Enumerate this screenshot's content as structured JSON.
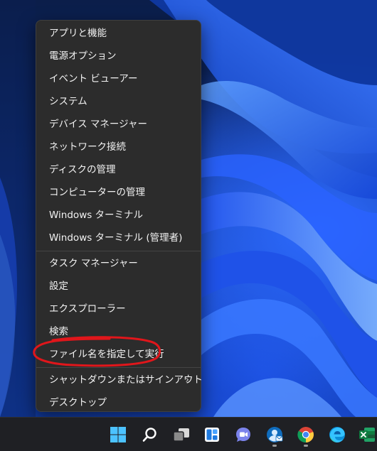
{
  "menu": {
    "items": [
      {
        "label": "アプリと機能"
      },
      {
        "label": "電源オプション"
      },
      {
        "label": "イベント ビューアー"
      },
      {
        "label": "システム"
      },
      {
        "label": "デバイス マネージャー"
      },
      {
        "label": "ネットワーク接続"
      },
      {
        "label": "ディスクの管理"
      },
      {
        "label": "コンピューターの管理"
      },
      {
        "label": "Windows ターミナル"
      },
      {
        "label": "Windows ターミナル (管理者)"
      }
    ],
    "items2": [
      {
        "label": "タスク マネージャー"
      },
      {
        "label": "設定"
      },
      {
        "label": "エクスプローラー"
      },
      {
        "label": "検索"
      },
      {
        "label": "ファイル名を指定して実行"
      }
    ],
    "items3": [
      {
        "label": "シャットダウンまたはサインアウト",
        "chevron": "›"
      },
      {
        "label": "デスクトップ"
      }
    ]
  },
  "taskbar": {
    "icons": [
      {
        "name": "start-icon"
      },
      {
        "name": "search-icon"
      },
      {
        "name": "task-view-icon"
      },
      {
        "name": "widgets-icon"
      },
      {
        "name": "teams-chat-icon"
      },
      {
        "name": "app-icon"
      },
      {
        "name": "chrome-icon"
      },
      {
        "name": "edge-icon"
      },
      {
        "name": "excel-icon"
      }
    ]
  },
  "colors": {
    "annotation": "#e0161b",
    "menu_bg": "#2c2c2c",
    "taskbar_bg": "#1f2024",
    "accent": "#0f6cbd"
  }
}
